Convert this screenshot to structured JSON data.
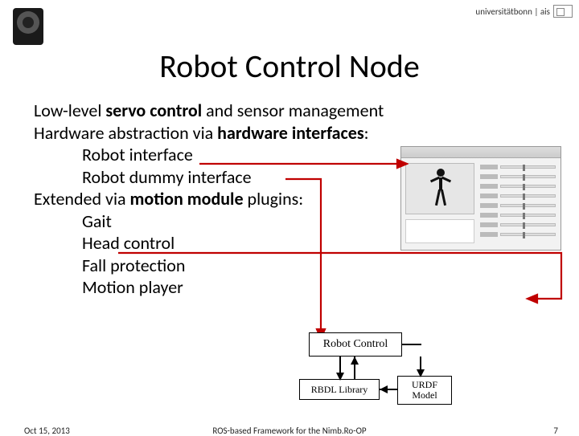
{
  "header": {
    "logo_text": "universitätbonn | ais"
  },
  "title": "Robot Control Node",
  "body": {
    "line1_a": "Low-level ",
    "line1_b": "servo control",
    "line1_c": " and sensor management",
    "line2_a": "Hardware abstraction via ",
    "line2_b": "hardware interfaces",
    "line2_c": ":",
    "hw_if_1": "Robot interface",
    "hw_if_2": "Robot dummy interface",
    "line3_a": "Extended via ",
    "line3_b": "motion module",
    "line3_c": " plugins:",
    "mm_1": "Gait",
    "mm_2": "Head control",
    "mm_3": "Fall protection",
    "mm_4": "Motion player"
  },
  "diagram": {
    "robot_control": "Robot Control",
    "rbdl": "RBDL Library",
    "urdf": "URDF Model"
  },
  "footer": {
    "date": "Oct 15, 2013",
    "center": "ROS-based Framework for the Nimb.Ro-OP",
    "page": "7"
  }
}
